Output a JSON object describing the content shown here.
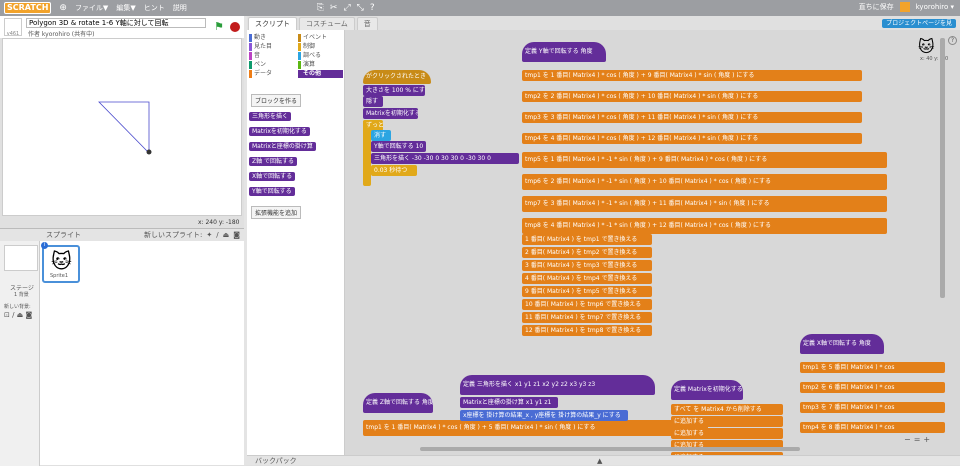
{
  "topbar": {
    "logo": "SCRATCH",
    "menu": [
      "ファイル▼",
      "編集▼",
      "ヒント",
      "説明"
    ],
    "save": "直ちに保存",
    "user": "kyorohiro ▾",
    "project_page": "プロジェクトページを見"
  },
  "stage": {
    "title": "Polygon 3D & rotate 1-6 Y軸に対して回転",
    "author": "作者 kyorohiro (共有中)",
    "version": "v461",
    "coords": "x: 240  y: -180"
  },
  "sprites": {
    "header": "スプライト",
    "new_sprite": "新しいスプライト:",
    "stage_label": "ステージ",
    "stage_sub": "1 背景",
    "new_bg": "新しい背景:",
    "sprite_name": "Sprite1"
  },
  "tabs": [
    "スクリプト",
    "コスチューム",
    "音"
  ],
  "palette": {
    "categories": [
      "動き",
      "イベント",
      "見た目",
      "制御",
      "音",
      "調べる",
      "ペン",
      "演算",
      "データ",
      "その他"
    ],
    "make_block": "ブロックを作る",
    "blocks": [
      "三角形を描く",
      "Matrixを初期化する",
      "Matrixと座標の掛け算",
      "Z軸 で回転する",
      "X軸で回転する",
      "Y軸で回転する"
    ],
    "add_ext": "拡張機能を追加"
  },
  "scripts": {
    "define_y": "定義 Y軸で回転する 角度",
    "define_x": "定義 X軸で回転する 角度",
    "define_z": "定義 Z軸で回転する 角度",
    "define_tri": "定義 三角形を描く x1 y1 z1 x2 y2 z2 x3 y3 z3",
    "define_init": "定義 Matrixを初期化する",
    "when_flag": "がクリックされたとき",
    "size": "大きさを 100 % にする",
    "hide": "隠す",
    "init": "Matrixを初期化する",
    "forever": "ずっと",
    "clear": "消す",
    "rotY": "Y軸で回転する 10",
    "tri": "三角形を描く -30 -30 0 30 30 0 -30 30 0",
    "wait": "0.03 秒待つ",
    "tmp_rows": [
      "tmp1 を 1 番目( Matrix4 ) * cos ( 角度 ) + 9 番目( Matrix4 ) * sin ( 角度 ) にする",
      "tmp2 を 2 番目( Matrix4 ) * cos ( 角度 ) + 10 番目( Matrix4 ) * sin ( 角度 ) にする",
      "tmp3 を 3 番目( Matrix4 ) * cos ( 角度 ) + 11 番目( Matrix4 ) * sin ( 角度 ) にする",
      "tmp4 を 4 番目( Matrix4 ) * cos ( 角度 ) + 12 番目( Matrix4 ) * sin ( 角度 ) にする",
      "tmp5 を 1 番目( Matrix4 ) * -1 * sin ( 角度 ) + 9 番目( Matrix4 ) * cos ( 角度 ) にする",
      "tmp6 を 2 番目( Matrix4 ) * -1 * sin ( 角度 ) + 10 番目( Matrix4 ) * cos ( 角度 ) にする",
      "tmp7 を 3 番目( Matrix4 ) * -1 * sin ( 角度 ) + 11 番目( Matrix4 ) * sin ( 角度 ) にする",
      "tmp8 を 4 番目( Matrix4 ) * -1 * sin ( 角度 ) + 12 番目( Matrix4 ) * cos ( 角度 ) にする"
    ],
    "replace_rows": [
      "1 番目( Matrix4 ) を tmp1 で置き換える",
      "2 番目( Matrix4 ) を tmp2 で置き換える",
      "3 番目( Matrix4 ) を tmp3 で置き換える",
      "4 番目( Matrix4 ) を tmp4 で置き換える",
      "9 番目( Matrix4 ) を tmp5 で置き換える",
      "10 番目( Matrix4 ) を tmp6 で置き換える",
      "11 番目( Matrix4 ) を tmp7 で置き換える",
      "12 番目( Matrix4 ) を tmp8 で置き換える"
    ],
    "z_tmp": "tmp1 を 1 番目( Matrix4 ) * cos ( 角度 ) + 5 番目( Matrix4 ) * sin ( 角度 ) にする",
    "tri_mul": "Matrixと座標の掛け算 x1 y1 z1",
    "tri_x": "x座標を 掛け算の結果_x , y座標を 掛け算の結果_y にする",
    "init_del": "すべて を Matrix4 から削除する",
    "x_rows": [
      "tmp1 を 5 番目( Matrix4 ) * cos",
      "tmp2 を 6 番目( Matrix4 ) * cos",
      "tmp3 を 7 番目( Matrix4 ) * cos",
      "tmp4 を 8 番目( Matrix4 ) * cos"
    ],
    "add_rows": [
      "に追加する",
      "に追加する",
      "に追加する",
      "に追加する"
    ],
    "xy": "x: 40\ny: -50"
  },
  "backpack": "バックパック",
  "zoom": [
    "−",
    "=",
    "+"
  ]
}
